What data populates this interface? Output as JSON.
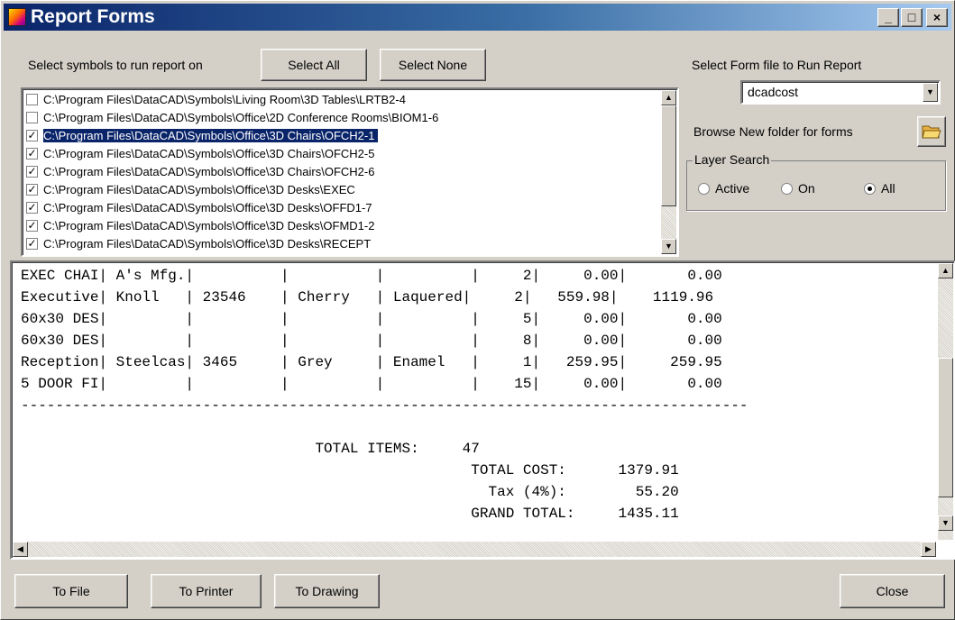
{
  "window": {
    "title": "Report Forms",
    "controls": {
      "minimize": "_",
      "maximize": "□",
      "close": "×"
    }
  },
  "symbols": {
    "prompt": "Select symbols to run report on",
    "select_all_label": "Select All",
    "select_none_label": "Select None",
    "items": [
      {
        "path": "C:\\Program Files\\DataCAD\\Symbols\\Living Room\\3D Tables\\LRTB2-4",
        "checked": false,
        "selected": false
      },
      {
        "path": "C:\\Program Files\\DataCAD\\Symbols\\Office\\2D Conference Rooms\\BIOM1-6",
        "checked": false,
        "selected": false
      },
      {
        "path": "C:\\Program Files\\DataCAD\\Symbols\\Office\\3D Chairs\\OFCH2-1",
        "checked": true,
        "selected": true
      },
      {
        "path": "C:\\Program Files\\DataCAD\\Symbols\\Office\\3D Chairs\\OFCH2-5",
        "checked": true,
        "selected": false
      },
      {
        "path": "C:\\Program Files\\DataCAD\\Symbols\\Office\\3D Chairs\\OFCH2-6",
        "checked": true,
        "selected": false
      },
      {
        "path": "C:\\Program Files\\DataCAD\\Symbols\\Office\\3D Desks\\EXEC",
        "checked": true,
        "selected": false
      },
      {
        "path": "C:\\Program Files\\DataCAD\\Symbols\\Office\\3D Desks\\OFFD1-7",
        "checked": true,
        "selected": false
      },
      {
        "path": "C:\\Program Files\\DataCAD\\Symbols\\Office\\3D Desks\\OFMD1-2",
        "checked": true,
        "selected": false
      },
      {
        "path": "C:\\Program Files\\DataCAD\\Symbols\\Office\\3D Desks\\RECEPT",
        "checked": true,
        "selected": false
      }
    ]
  },
  "form": {
    "prompt": "Select Form file to Run Report",
    "selected_form": "dcadcost",
    "browse_label": "Browse New folder for forms"
  },
  "layer_search": {
    "title": "Layer Search",
    "options": [
      {
        "label": "Active",
        "selected": false
      },
      {
        "label": "On",
        "selected": false
      },
      {
        "label": "All",
        "selected": true
      }
    ]
  },
  "report": {
    "lines": [
      "EXEC CHAI| A's Mfg.|          |          |          |     2|     0.00|       0.00",
      "Executive| Knoll   | 23546    | Cherry   | Laquered|     2|   559.98|    1119.96",
      "60x30 DES|         |          |          |          |     5|     0.00|       0.00",
      "60x30 DES|         |          |          |          |     8|     0.00|       0.00",
      "Reception| Steelcas| 3465     | Grey     | Enamel   |     1|   259.95|     259.95",
      "5 DOOR FI|         |          |          |          |    15|     0.00|       0.00",
      "------------------------------------------------------------------------------------",
      "",
      "                                  TOTAL ITEMS:     47",
      "                                                    TOTAL COST:      1379.91",
      "                                                      Tax (4%):        55.20",
      "                                                    GRAND TOTAL:     1435.11"
    ]
  },
  "actions": {
    "to_file": "To File",
    "to_printer": "To Printer",
    "to_drawing": "To Drawing",
    "close": "Close"
  }
}
